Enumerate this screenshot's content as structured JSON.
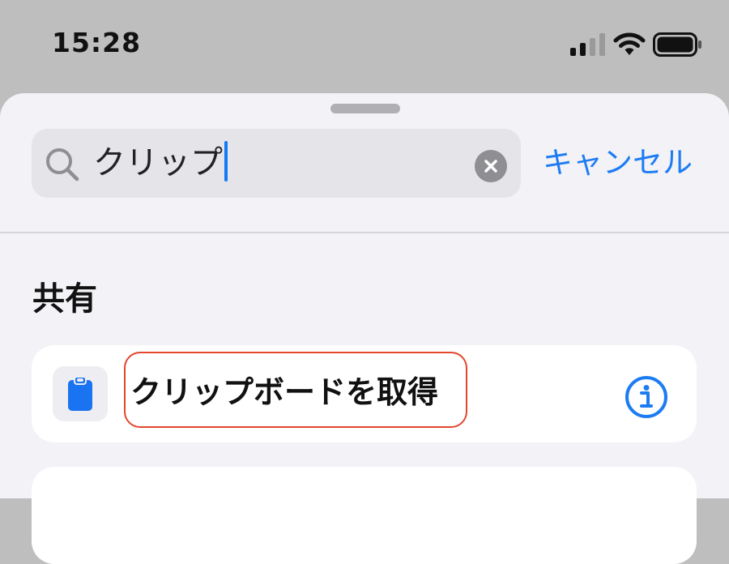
{
  "status_bar": {
    "time": "15:28",
    "signal_icon": "cellular-signal-icon",
    "wifi_icon": "wifi-icon",
    "battery_icon": "battery-icon"
  },
  "search": {
    "query": "クリップ",
    "clear_icon": "clear-icon",
    "cancel_label": "キャンセル"
  },
  "section": {
    "title": "共有"
  },
  "actions": [
    {
      "label": "クリップボードを取得",
      "icon": "clipboard-icon",
      "info_icon": "info-icon"
    }
  ],
  "colors": {
    "accent": "#1d7cf2",
    "highlight_border": "#e4462e",
    "sheet_background": "#f2f2f7",
    "backdrop": "#bebebe"
  }
}
